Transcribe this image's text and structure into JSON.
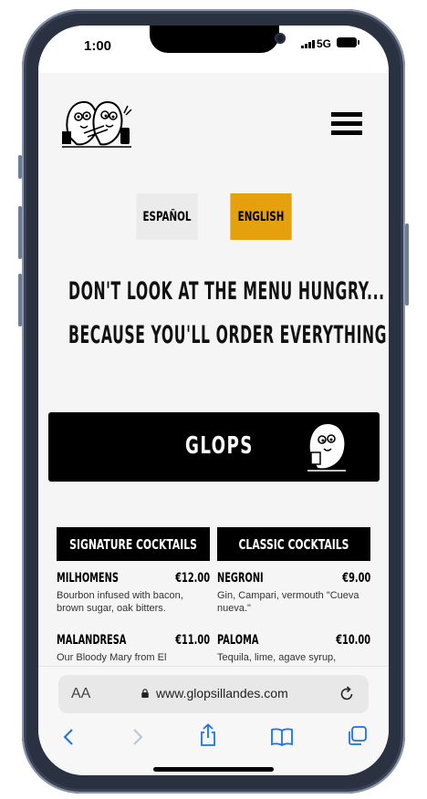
{
  "status": {
    "time": "1:00",
    "network": "5G"
  },
  "languages": {
    "es": "ESPAÑOL",
    "en": "ENGLISH",
    "active": "en"
  },
  "headline": {
    "line1": "DON'T LOOK AT THE MENU HUNGRY...",
    "line2": "BECAUSE YOU'LL ORDER EVERYTHING"
  },
  "brand": {
    "name": "GLOPS"
  },
  "tabs": [
    {
      "label": "SIGNATURE COCKTAILS"
    },
    {
      "label": "CLASSIC COCKTAILS"
    }
  ],
  "signature": [
    {
      "name": "MILHOMENS",
      "price": "€12.00",
      "desc": "Bourbon infused with bacon, brown sugar, oak bitters."
    },
    {
      "name": "MALANDRESA",
      "price": "€11.00",
      "desc": "Our Bloody Mary from El"
    }
  ],
  "classic": [
    {
      "name": "NEGRONI",
      "price": "€9.00",
      "desc": "Gin, Campari, vermouth \"Cueva nueva.\""
    },
    {
      "name": "PALOMA",
      "price": "€10.00",
      "desc": "Tequila, lime, agave syrup,"
    }
  ],
  "browser": {
    "aa": "AA",
    "url": "www.glopsillandes.com"
  },
  "colors": {
    "accent": "#e5a10b",
    "ios_blue": "#1a73e8"
  }
}
